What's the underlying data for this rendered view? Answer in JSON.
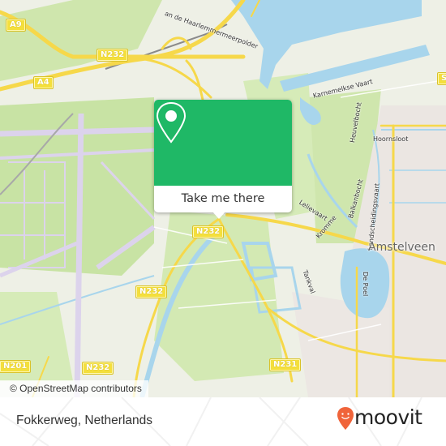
{
  "map": {
    "popup": {
      "cta_label": "Take me there",
      "icon": "location-pin-icon",
      "accent_color": "#1fb866"
    },
    "road_shields": [
      {
        "label": "A9"
      },
      {
        "label": "N232"
      },
      {
        "label": "A4"
      },
      {
        "label": "N232"
      },
      {
        "label": "N232"
      },
      {
        "label": "N201"
      },
      {
        "label": "N232"
      },
      {
        "label": "N231"
      },
      {
        "label": "S"
      }
    ],
    "labels": {
      "karnemelkse_vaart": "Karnemelkse Vaart",
      "hoornsloot": "Hoornsloot",
      "heuvelbocht": "Heuvelbocht",
      "balkanbocht": "Balkanbocht",
      "landscheidingsvaart": "Landscheidingsvaart",
      "lelievaart": "Lelievaart",
      "kromme": "Kromme",
      "tankval": "Tankval",
      "de_poel": "De Poel",
      "haarlemmermeerpolder": "an de Haarlemmermeerpolder",
      "city": "Amstelveen"
    },
    "attribution": "© OpenStreetMap contributors"
  },
  "footer": {
    "location_title": "Fokkerweg, Netherlands",
    "brand": "moovit",
    "brand_color": "#f0643a"
  }
}
